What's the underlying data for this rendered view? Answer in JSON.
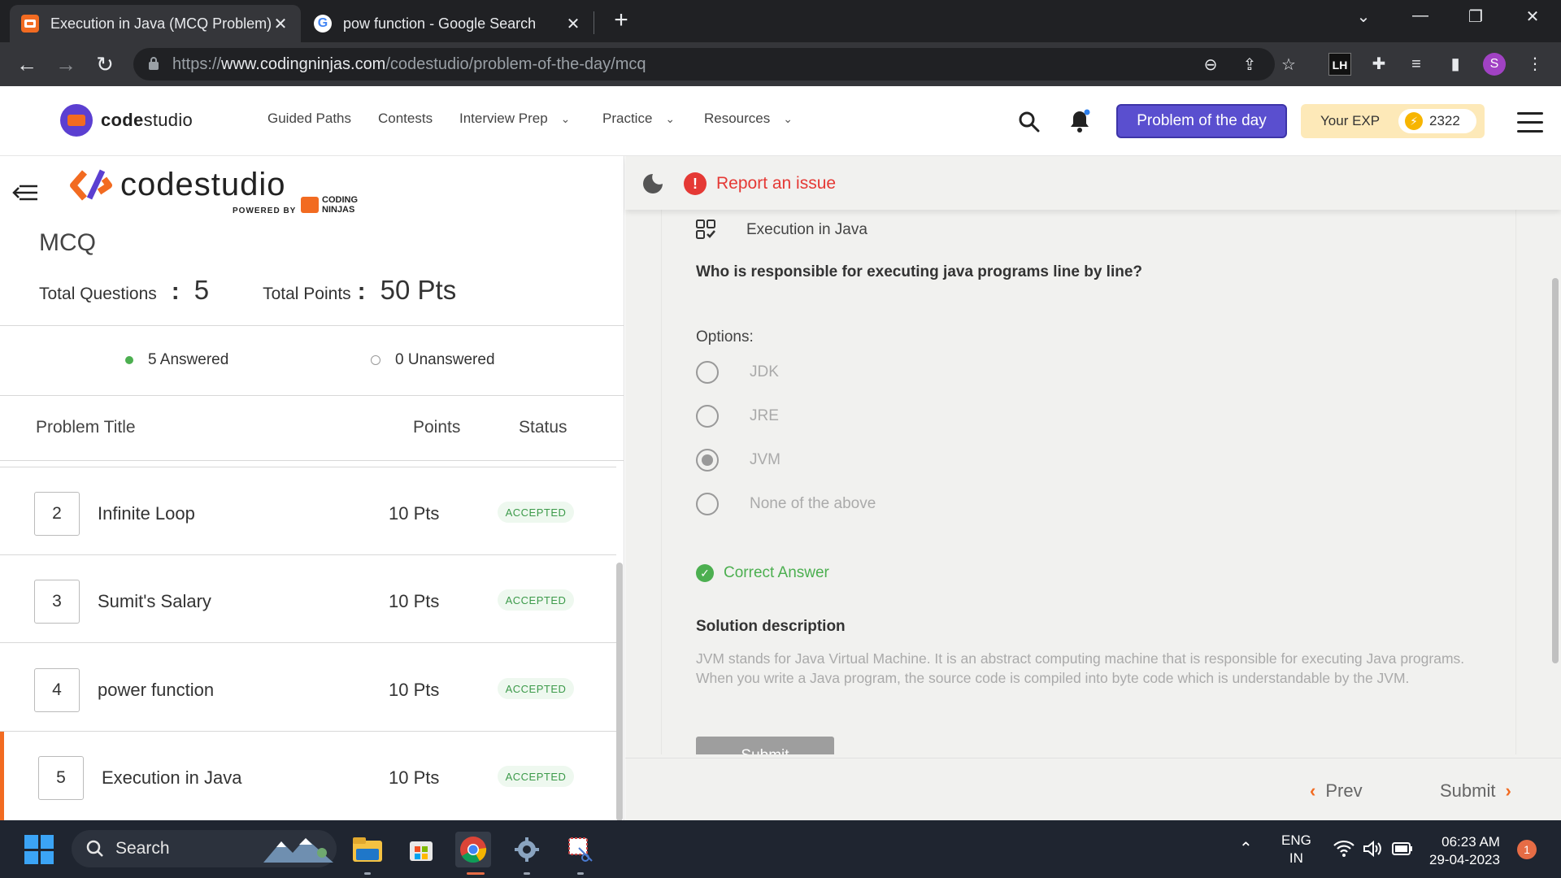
{
  "browser": {
    "tabs": [
      {
        "title": "Execution in Java (MCQ Problem)",
        "active": true
      },
      {
        "title": "pow function - Google Search",
        "active": false
      }
    ],
    "url_prefix": "https://",
    "url_host": "www.codingninjas.com",
    "url_path": "/codestudio/problem-of-the-day/mcq",
    "profile_initial": "S",
    "extension_badge": "LH"
  },
  "site_header": {
    "brand_bold": "code",
    "brand_light": "studio",
    "nav": [
      "Guided Paths",
      "Contests",
      "Interview Prep",
      "Practice",
      "Resources"
    ],
    "nav_dropdowns": [
      false,
      false,
      true,
      true,
      true
    ],
    "potd_label": "Problem of the day",
    "exp_label": "Your EXP",
    "exp_value": "2322",
    "accent": "#5a4fcf",
    "brand_orange": "#f26b21"
  },
  "left_panel": {
    "logo_word": "codestudio",
    "powered_by": "POWERED BY",
    "cn_line1": "CODING",
    "cn_line2": "NINJAS",
    "title": "MCQ",
    "total_questions_label": "Total Questions",
    "total_questions_sep": ":",
    "total_questions": "5",
    "total_points_label": "Total Points",
    "total_points_sep": ":",
    "total_points": "50 Pts",
    "answered": "5 Answered",
    "unanswered": "0 Unanswered",
    "columns": {
      "title": "Problem Title",
      "points": "Points",
      "status": "Status"
    },
    "rows": [
      {
        "num": "2",
        "name": "Infinite Loop",
        "points": "10 Pts",
        "status": "ACCEPTED"
      },
      {
        "num": "3",
        "name": "Sumit's Salary",
        "points": "10 Pts",
        "status": "ACCEPTED"
      },
      {
        "num": "4",
        "name": "power function",
        "points": "10 Pts",
        "status": "ACCEPTED"
      },
      {
        "num": "5",
        "name": "Execution in Java",
        "points": "10 Pts",
        "status": "ACCEPTED"
      }
    ]
  },
  "right_panel": {
    "report": "Report an issue",
    "question_name": "Execution in Java",
    "question": "Who is responsible for executing java programs line by line?",
    "options_label": "Options:",
    "options": [
      "JDK",
      "JRE",
      "JVM",
      "None of the above"
    ],
    "selected_option": "JVM",
    "correct": "Correct Answer",
    "solution_title": "Solution description",
    "solution_text": "JVM stands for Java Virtual Machine. It is an abstract computing machine that is responsible for executing Java programs. When you write a Java program, the source code is compiled into byte code which is understandable by the JVM.",
    "submit_inner": "Submit",
    "prev": "Prev",
    "next": "Submit"
  },
  "taskbar": {
    "search": "Search",
    "lang1": "ENG",
    "lang2": "IN",
    "time": "06:23 AM",
    "date": "29-04-2023",
    "notifications": "1"
  }
}
